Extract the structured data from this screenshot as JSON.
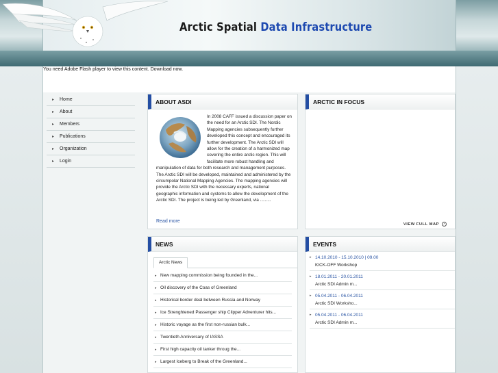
{
  "header": {
    "title_part1": "Arctic Spatial",
    "title_part2": "Data Infrastructure",
    "accent_color": "#1d49b0"
  },
  "flash_notice": "You need Adobe Flash player to view this content. Download now.",
  "sidebar": {
    "items": [
      {
        "label": "Home"
      },
      {
        "label": "About"
      },
      {
        "label": "Members"
      },
      {
        "label": "Publications"
      },
      {
        "label": "Organization"
      },
      {
        "label": "Login"
      }
    ]
  },
  "about": {
    "heading": "ABOUT ASDI",
    "paragraph1": "In 2008 CAFF issued a discussion paper on the need for an Arctic SDI. The Nordic Mapping agencies subsequently further developed this concept and encouraged its further development.  The Arctic SDI will allow for the creation of a harmonized map covering the entire arctic region. This will facilitate more robust handling and manipulation of data for both research and management purposes.",
    "paragraph2": "The Arctic SDI will be developed, maintained and administered by the circumpolar National Mapping Agencies. The mapping agencies will provide the Arctic SDI with the necessary experts, national geographic information and systems to allow the development of the Arctic SDI.  The project is being led by Greenland, via .........",
    "read_more": "Read more"
  },
  "focus": {
    "heading": "ARCTIC IN FOCUS",
    "view_map": "VIEW FULL MAP"
  },
  "news": {
    "heading": "NEWS",
    "tab": "Arctic News",
    "items": [
      {
        "text": "New mapping commission being founded in the..."
      },
      {
        "text": "Oil discovery of the Coas of Greenland"
      },
      {
        "text": "Historical border deal between Russia and Norway"
      },
      {
        "text": "Ice Strenghtened Passenger ship Clipper Adventurer hits..."
      },
      {
        "text": "Historic voyage as the first non-russian bulk..."
      },
      {
        "text": "Twentieth Anniversary of IASSA"
      },
      {
        "text": "First high capacity oil tanker throug the..."
      },
      {
        "text": "Largest Iceberg to Break of the Greenland..."
      }
    ]
  },
  "events": {
    "heading": "EVENTS",
    "items": [
      {
        "date": "14.10.2010 - 15.10.2010 | 09.00",
        "title": "KICK-OFF Workshop"
      },
      {
        "date": "18.01.2011 - 20.01.2011",
        "title": "Arctic SDI Admin m..."
      },
      {
        "date": "05.04.2011 - 06.04.2011",
        "title": "Arctic SDI Worksho..."
      },
      {
        "date": "05.04.2011 - 06.04.2011",
        "title": "Arctic SDI Admin m..."
      }
    ]
  }
}
